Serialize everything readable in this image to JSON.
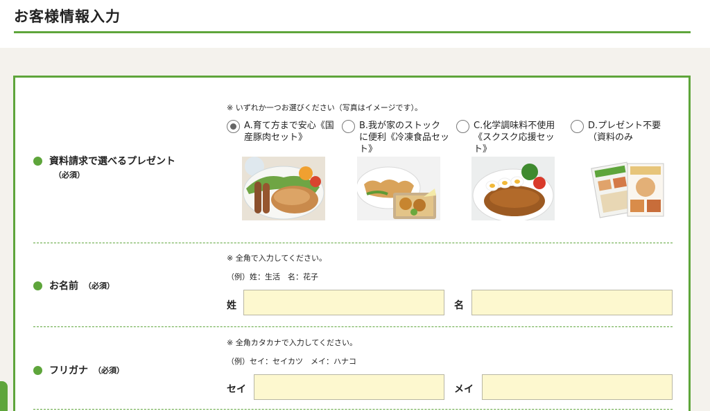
{
  "page": {
    "title": "お客様情報入力"
  },
  "colors": {
    "accent": "#5ea53b",
    "input_bg": "#fdf8cf"
  },
  "present": {
    "label": "資料請求で選べるプレゼント",
    "required": "（必須）",
    "note": "※ いずれか一つお選びください（写真はイメージです）。",
    "selected": "A",
    "options": [
      {
        "id": "A",
        "label": "A.育て方まで安心《国産豚肉セット》",
        "photo": "pork-meal-photo"
      },
      {
        "id": "B",
        "label": "B.我が家のストックに便利《冷凍食品セット》",
        "photo": "frozen-food-photo"
      },
      {
        "id": "C",
        "label": "C.化学調味料不使用《スクスク応援セット》",
        "photo": "curry-photo"
      },
      {
        "id": "D",
        "label": "D.プレゼント不要（資料のみ",
        "photo": "catalog-photo"
      }
    ]
  },
  "name": {
    "label": "お名前",
    "required": "（必須）",
    "note": "※ 全角で入力してください。",
    "example": "（例）姓：生活　名：花子",
    "last_label": "姓",
    "first_label": "名",
    "last_value": "",
    "first_value": ""
  },
  "furigana": {
    "label": "フリガナ",
    "required": "（必須）",
    "note": "※ 全角カタカナで入力してください。",
    "example": "（例）セイ：セイカツ　メイ：ハナコ",
    "last_label": "セイ",
    "first_label": "メイ",
    "last_value": "",
    "first_value": ""
  }
}
